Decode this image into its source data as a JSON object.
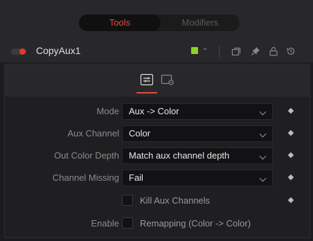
{
  "tabs": {
    "tools": "Tools",
    "modifiers": "Modifiers"
  },
  "node": {
    "name": "CopyAux1",
    "color": "#8fd31e"
  },
  "header_icons": [
    "stack-icon",
    "pin-icon",
    "lock-icon",
    "reset-icon"
  ],
  "panel_tabs": [
    "controls-tab-icon",
    "settings-tab-icon"
  ],
  "controls": {
    "mode": {
      "label": "Mode",
      "value": "Aux -> Color"
    },
    "aux_channel": {
      "label": "Aux Channel",
      "value": "Color"
    },
    "out_color_depth": {
      "label": "Out Color Depth",
      "value": "Match aux channel depth"
    },
    "channel_missing": {
      "label": "Channel Missing",
      "value": "Fail"
    },
    "kill_aux": {
      "label": "Kill Aux Channels",
      "checked": false
    },
    "enable": {
      "label": "Enable",
      "checkbox_label": "Remapping (Color -> Color)",
      "checked": false
    }
  },
  "colors": {
    "accent": "#e64b3c",
    "power": "#e23a2c"
  }
}
